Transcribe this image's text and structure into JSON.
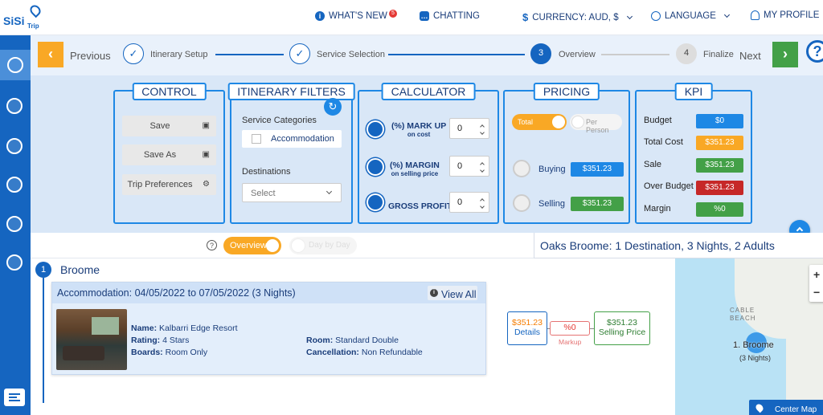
{
  "app": {
    "logo_main": "SiSi",
    "logo_sub": "Trip"
  },
  "topnav": {
    "whats_new": "WHAT'S NEW",
    "whats_new_count": "5",
    "chatting": "CHATTING",
    "currency": "CURRENCY: AUD, $",
    "language": "LANGUAGE",
    "profile": "MY PROFILE"
  },
  "stepper": {
    "previous": "Previous",
    "next": "Next",
    "steps": [
      {
        "label": "Itinerary Setup",
        "state": "done"
      },
      {
        "label": "Service Selection",
        "state": "done"
      },
      {
        "label": "Overview",
        "number": "3",
        "state": "current"
      },
      {
        "label": "Finalize",
        "number": "4",
        "state": "pending"
      }
    ],
    "help": "?"
  },
  "control": {
    "title": "CONTROL",
    "save": "Save",
    "save_as": "Save As",
    "trip_preferences": "Trip Preferences"
  },
  "filters": {
    "title": "ITINERARY FILTERS",
    "service_categories_label": "Service Categories",
    "category": "Accommodation",
    "destinations_label": "Destinations",
    "destinations_value": "Select"
  },
  "calculator": {
    "title": "CALCULATOR",
    "markup_label": "(%) MARK UP",
    "markup_sub": "on cost",
    "markup_value": "0",
    "margin_label": "(%) MARGIN",
    "margin_sub": "on selling price",
    "margin_value": "0",
    "gross_label": "GROSS PROFIT",
    "gross_value": "0"
  },
  "pricing": {
    "title": "PRICING",
    "toggle_on": "Total",
    "toggle_off": "Per Person",
    "buying_label": "Buying",
    "buying_value": "$351.23",
    "selling_label": "Selling",
    "selling_value": "$351.23"
  },
  "kpi": {
    "title": "KPI",
    "rows": [
      {
        "label": "Budget",
        "value": "$0",
        "color": "#1e88e5"
      },
      {
        "label": "Total Cost",
        "value": "$351.23",
        "color": "#f9a825"
      },
      {
        "label": "Sale",
        "value": "$351.23",
        "color": "#43a047"
      },
      {
        "label": "Over Budget",
        "value": "$351.23",
        "color": "#c62828"
      },
      {
        "label": "Margin",
        "value": "%0",
        "color": "#43a047"
      }
    ]
  },
  "view": {
    "help": "?",
    "overview": "Overview",
    "day_by_day": "Day by Day"
  },
  "summary": "Oaks Broome: 1 Destination, 3 Nights, 2 Adults",
  "destination": {
    "number": "1",
    "name": "Broome",
    "card": {
      "title": "Accommodation: 04/05/2022 to 07/05/2022 (3 Nights)",
      "view_all": "View All",
      "name_label": "Name:",
      "name": "Kalbarri Edge Resort",
      "rating_label": "Rating:",
      "rating": "4 Stars",
      "boards_label": "Boards:",
      "boards": "Room Only",
      "room_label": "Room:",
      "room": "Standard Double",
      "cancel_label": "Cancellation:",
      "cancel": "Non Refundable"
    },
    "price": {
      "details_value": "$351.23",
      "details_label": "Details",
      "markup_value": "%0",
      "markup_label": "Markup",
      "selling_value": "$351.23",
      "selling_label": "Selling Price"
    }
  },
  "map": {
    "area_label_1": "CABLE",
    "area_label_2": "BEACH",
    "marker_name": "1. Broome",
    "marker_sub": "(3 Nights)",
    "zoom_in": "+",
    "zoom_out": "−",
    "center": "Center Map"
  }
}
